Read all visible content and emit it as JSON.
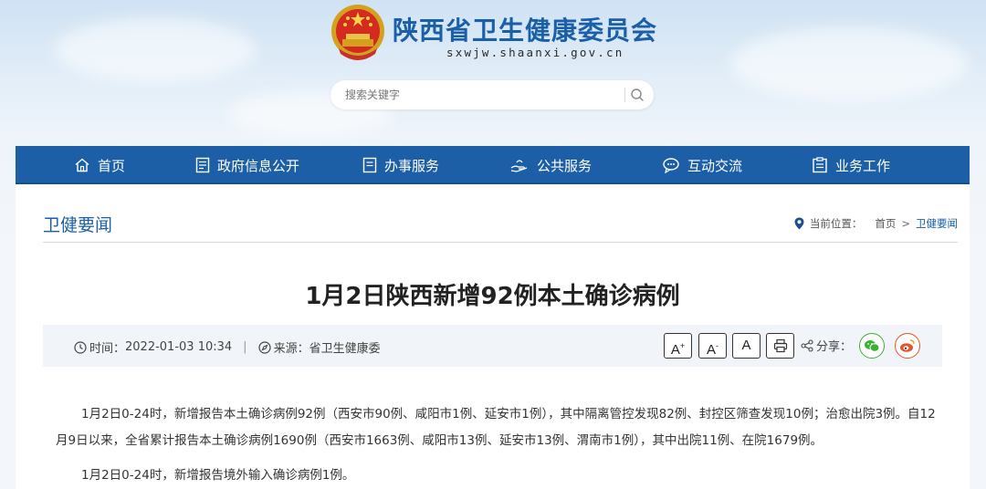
{
  "header": {
    "site_title": "陕西省卫生健康委员会",
    "site_domain": "sxwjw.shaanxi.gov.cn",
    "search_placeholder": "搜索关键字"
  },
  "nav": {
    "items": [
      {
        "label": "首页",
        "icon": "home-icon"
      },
      {
        "label": "政府信息公开",
        "icon": "document-list-icon"
      },
      {
        "label": "办事服务",
        "icon": "form-icon"
      },
      {
        "label": "公共服务",
        "icon": "hand-service-icon"
      },
      {
        "label": "互动交流",
        "icon": "chat-bubble-icon"
      },
      {
        "label": "业务工作",
        "icon": "clipboard-icon"
      }
    ]
  },
  "section": {
    "title": "卫健要闻",
    "breadcrumb_label": "当前位置：",
    "breadcrumb_home": "首页",
    "breadcrumb_sep": ">",
    "breadcrumb_current": "卫健要闻"
  },
  "article": {
    "title": "1月2日陕西新增92例本土确诊病例",
    "time_label": "时间：",
    "time_value": "2022-01-03 10:34",
    "source_label": "来源：",
    "source_value": "省卫生健康委",
    "font_large": "A",
    "font_small": "A",
    "font_normal": "A",
    "share_label": "分享：",
    "paragraphs": [
      "1月2日0-24时，新增报告本土确诊病例92例（西安市90例、咸阳市1例、延安市1例），其中隔离管控发现82例、封控区筛查发现10例；治愈出院3例。自12月9日以来，全省累计报告本土确诊病例1690例（西安市1663例、咸阳市13例、延安市13例、渭南市1例），其中出院11例、在院1679例。",
      "1月2日0-24时，新增报告境外输入确诊病例1例。"
    ]
  },
  "colors": {
    "brand_blue": "#1d5fa6",
    "title_blue": "#1a5fa8",
    "wechat_green": "#3cb034",
    "weibo_red": "#e6522c"
  }
}
